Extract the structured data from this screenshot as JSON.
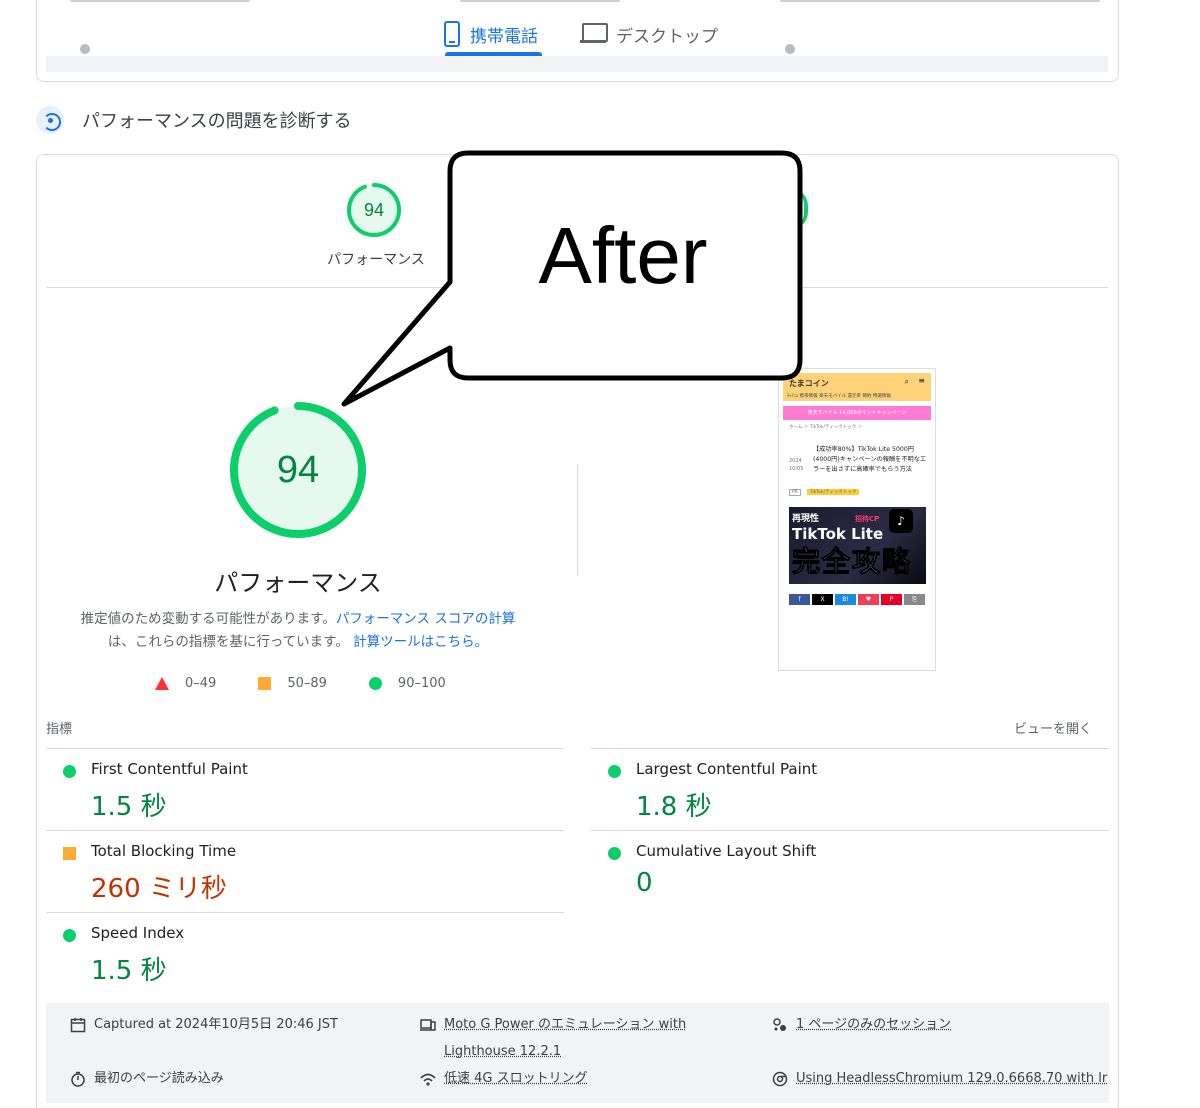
{
  "tabs": {
    "mobile": "携帯電話",
    "desktop": "デスクトップ"
  },
  "section": {
    "title": "パフォーマンスの問題を診断する"
  },
  "summary": {
    "score": "94",
    "label": "パフォーマンス"
  },
  "performance": {
    "score": "94",
    "score_value": 0.94,
    "label": "パフォーマンス",
    "desc_prefix": "推定値のため変動する可能性があります。",
    "desc_link": "パフォーマンス スコアの計算",
    "desc_middle": "は、これらの指標を基に行っています。",
    "desc_link2": "計算ツールはこちら。"
  },
  "legend": {
    "poor": "0–49",
    "average": "50–89",
    "good": "90–100"
  },
  "thumbnail": {
    "logo": "たまコイン",
    "nav": "ﾁｬﾘﾆﾑ  携帯情報  楽天モバイル  還元率  節約  特選情報",
    "banner": "楽天モバイル 14,000ポイントキャンペーン",
    "crumb": "ホーム ＞ TikTok/ティックトック ＞",
    "date": "2024\n10/05",
    "title": "【成功率80%】TikTok Lite 5000円(4000円)キャンペーンの報酬を不明なエラーを出さずに高確率でもらう方法",
    "tags": "PR",
    "tag_yellow": "TikTok/ティックトック",
    "hero_line1": "再現性",
    "hero_line1b": "招待CP",
    "hero_line2": "TikTok Lite",
    "hero_line3": "完全攻略",
    "share": [
      "f",
      "X",
      "B!",
      "♥",
      "P",
      "⎘"
    ]
  },
  "metrics": {
    "header": "指標",
    "expand": "ビューを開く",
    "fcp": {
      "name": "First Contentful Paint",
      "value": "1.5 秒"
    },
    "lcp": {
      "name": "Largest Contentful Paint",
      "value": "1.8 秒"
    },
    "tbt": {
      "name": "Total Blocking Time",
      "value": "260 ミリ秒"
    },
    "cls": {
      "name": "Cumulative Layout Shift",
      "value": "0"
    },
    "si": {
      "name": "Speed Index",
      "value": "1.5 秒"
    }
  },
  "footer": {
    "captured": "Captured at 2024年10月5日 20:46 JST",
    "device": "Moto G Power のエミュレーション with",
    "device2": "Lighthouse 12.2.1",
    "session": "1 ページのみのセッション",
    "load": "最初のページ読み込み",
    "throttle": "低速 4G スロットリング",
    "browser": "Using HeadlessChromium 129.0.6668.70 with lr"
  },
  "callout": {
    "text": "After"
  },
  "colors": {
    "accent": "#1a73e8",
    "good": "#0cce6b",
    "good_text": "#018642",
    "average": "#ffaa33",
    "average_text": "#c33300",
    "poor": "#ff3333"
  }
}
